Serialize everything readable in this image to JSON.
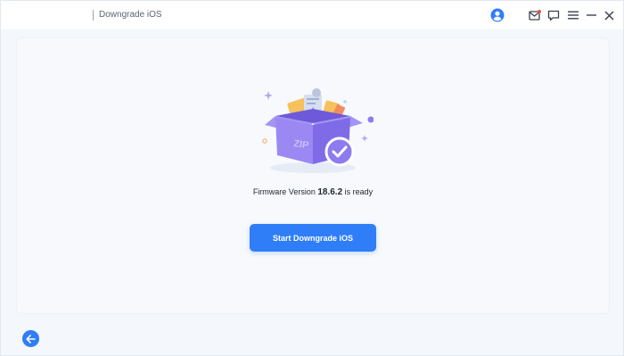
{
  "titlebar": {
    "breadcrumb": "Downgrade iOS",
    "icons": [
      "user-avatar-icon",
      "mail-icon",
      "feedback-icon",
      "menu-icon",
      "minimize-icon",
      "close-icon"
    ],
    "notification_dot_color": "#f0503c"
  },
  "main": {
    "illustration": "zip-box-with-checkmark",
    "firmware_prefix": "Firmware Version ",
    "firmware_version": "18.6.2",
    "firmware_suffix": " is ready",
    "start_button_label": "Start Downgrade iOS"
  },
  "footer": {
    "back_icon": "arrow-left-icon"
  },
  "colors": {
    "accent": "#2f7ef7",
    "box_purple": "#8e7bf0",
    "background": "#f4f7fc"
  }
}
